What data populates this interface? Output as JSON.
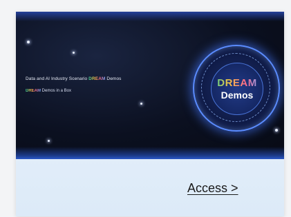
{
  "banner": {
    "headline_prefix": "Data and AI Industry Scenario ",
    "headline_highlight": "DREAM",
    "headline_suffix": " Demos",
    "subline_highlight": "DREAM",
    "subline_suffix": " Demos in a Box",
    "badge_top": "DREAM",
    "badge_bottom": "Demos"
  },
  "card": {
    "access_label": "Access >"
  },
  "colors": {
    "banner_bg": "#0b1020",
    "card_bg": "#dceaf8",
    "badge_ring": "#5b8cff",
    "link_text": "#1a1a1a"
  }
}
